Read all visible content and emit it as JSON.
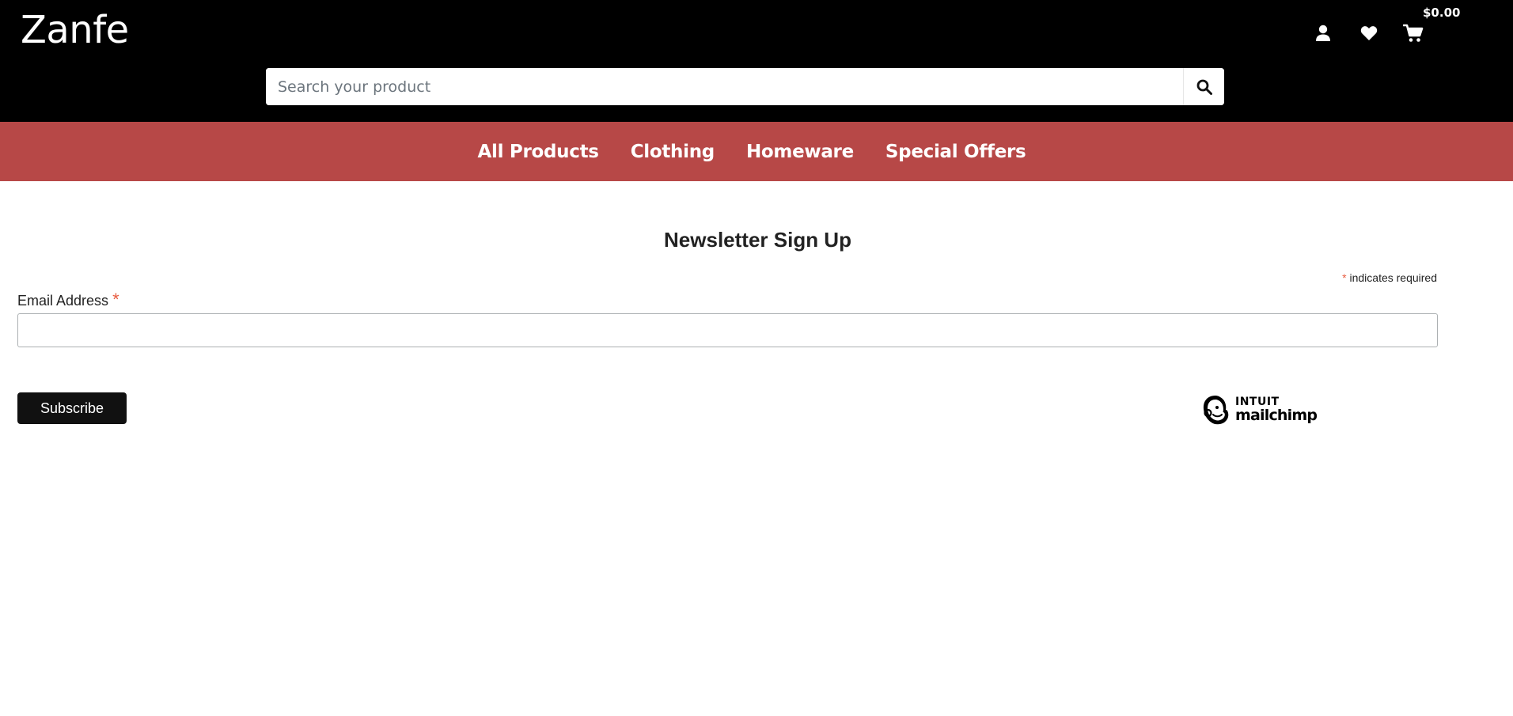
{
  "header": {
    "brand": "Zanfe",
    "cart_total": "$0.00",
    "icons": [
      "user-icon",
      "heart-icon",
      "cart-icon"
    ],
    "search": {
      "placeholder": "Search your product",
      "value": "",
      "icon": "search-icon"
    },
    "colors": {
      "background": "#000000"
    }
  },
  "nav": {
    "background": "#b74847",
    "items": [
      {
        "label": "All Products"
      },
      {
        "label": "Clothing"
      },
      {
        "label": "Homeware"
      },
      {
        "label": "Special Offers"
      }
    ]
  },
  "newsletter": {
    "title": "Newsletter Sign Up",
    "required_asterisk": "*",
    "required_note": "indicates required",
    "email_label": "Email Address",
    "email_value": "",
    "subscribe_label": "Subscribe",
    "badge": {
      "line1": "INTUIT",
      "line2": "mailchimp",
      "icon": "mailchimp-freddie-icon"
    },
    "accent_color": "#e85c41"
  }
}
